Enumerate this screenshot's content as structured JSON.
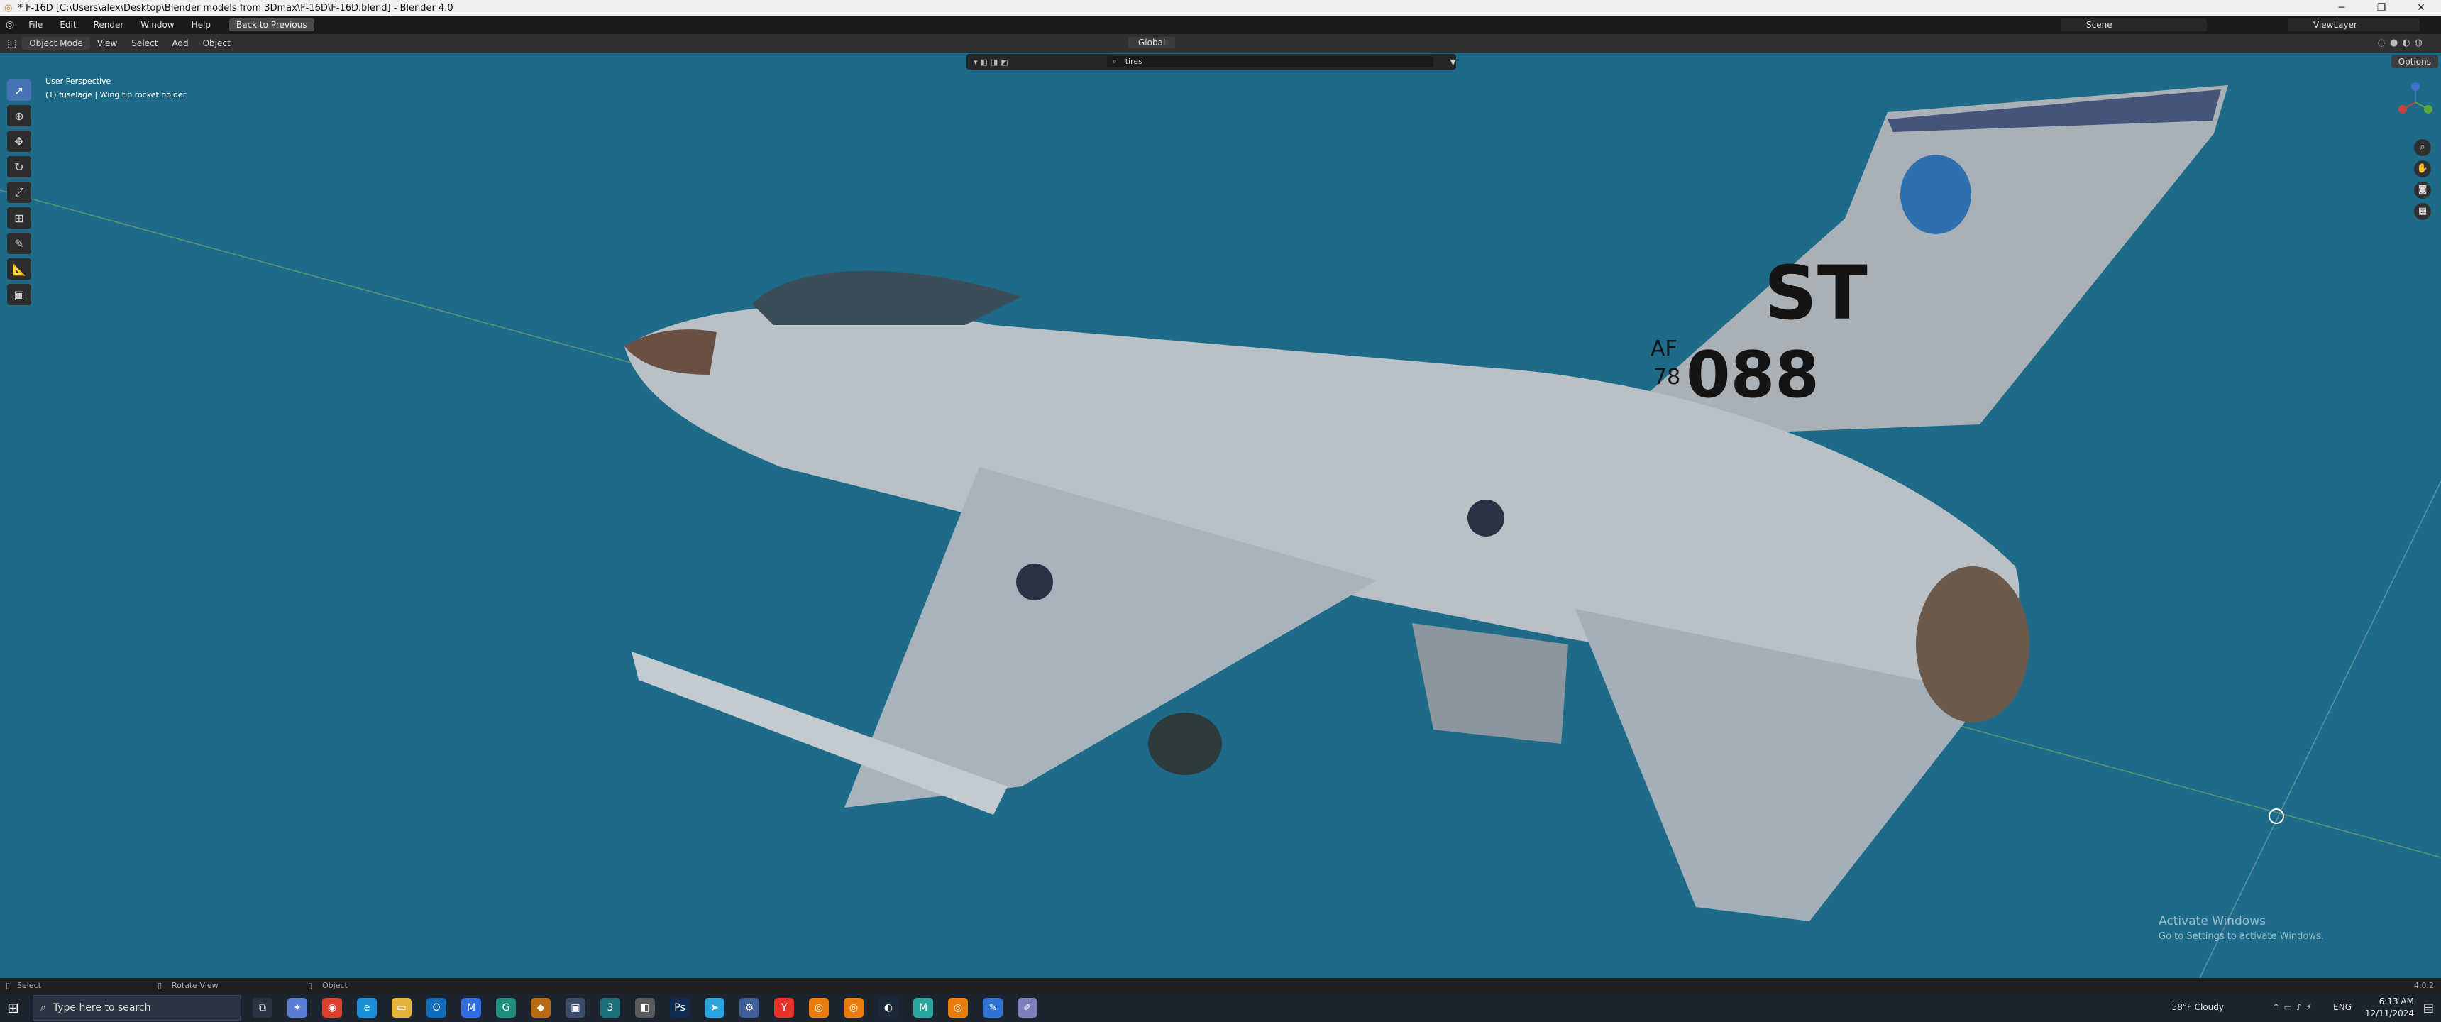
{
  "window": {
    "title": "* F-16D [C:\\Users\\alex\\Desktop\\Blender models from 3Dmax\\F-16D\\F-16D.blend] - Blender 4.0",
    "minimize": "─",
    "maximize": "❐",
    "close": "✕"
  },
  "menubar": {
    "items": [
      "File",
      "Edit",
      "Render",
      "Window",
      "Help"
    ],
    "back_button": "Back to Previous",
    "scene": "Scene",
    "view_layer": "ViewLayer"
  },
  "header": {
    "mode": "Object Mode",
    "menus": [
      "View",
      "Select",
      "Add",
      "Object"
    ],
    "orientation": "Global",
    "options": "Options"
  },
  "outliner_filter": {
    "search_value": "tires"
  },
  "viewport": {
    "perspective_label": "User Perspective",
    "selection_label": "(1) fuselage | Wing tip rocket holder"
  },
  "aircraft": {
    "tail_code": "ST",
    "af_label": "AF",
    "year": "78",
    "serial": "088"
  },
  "toolbar": {
    "tools": [
      "select-box",
      "cursor",
      "move",
      "rotate",
      "scale",
      "transform",
      "annotate",
      "measure",
      "add-cube"
    ]
  },
  "watermark": {
    "line1": "Activate Windows",
    "line2": "Go to Settings to activate Windows."
  },
  "statusbar": {
    "select": "Select",
    "rotate": "Rotate View",
    "object": "Object",
    "version": "4.0.2"
  },
  "taskbar": {
    "search_placeholder": "Type here to search",
    "weather": "58°F  Cloudy",
    "language": "ENG",
    "time": "6:13 AM",
    "date": "12/11/2024",
    "apps": [
      {
        "name": "task-view",
        "glyph": "⧉",
        "color": "#2b3441"
      },
      {
        "name": "copilot",
        "glyph": "✦",
        "color": "#5a7dd6"
      },
      {
        "name": "chrome",
        "glyph": "◉",
        "color": "#d9412e"
      },
      {
        "name": "edge",
        "glyph": "e",
        "color": "#1d8fd6"
      },
      {
        "name": "file-explorer",
        "glyph": "▭",
        "color": "#e4b43a"
      },
      {
        "name": "outlook",
        "glyph": "O",
        "color": "#0f6cbd"
      },
      {
        "name": "messenger",
        "glyph": "M",
        "color": "#2f6de1"
      },
      {
        "name": "gitkraken",
        "glyph": "G",
        "color": "#1f8f7b"
      },
      {
        "name": "app-1",
        "glyph": "◆",
        "color": "#b66a12"
      },
      {
        "name": "app-2",
        "glyph": "▣",
        "color": "#3d4c6b"
      },
      {
        "name": "3ds-max",
        "glyph": "3",
        "color": "#1d6f7a"
      },
      {
        "name": "app-3",
        "glyph": "◧",
        "color": "#5a5a5a"
      },
      {
        "name": "photoshop",
        "glyph": "Ps",
        "color": "#0f2d52"
      },
      {
        "name": "telegram",
        "glyph": "➤",
        "color": "#2aa3de"
      },
      {
        "name": "settings",
        "glyph": "⚙",
        "color": "#3f5f9a"
      },
      {
        "name": "yandex",
        "glyph": "Y",
        "color": "#e63228"
      },
      {
        "name": "blender-1",
        "glyph": "◎",
        "color": "#e87d0d"
      },
      {
        "name": "blender-2",
        "glyph": "◎",
        "color": "#e87d0d"
      },
      {
        "name": "steam",
        "glyph": "◐",
        "color": "#1b2838"
      },
      {
        "name": "maya",
        "glyph": "M",
        "color": "#2aa6a0"
      },
      {
        "name": "blender-3",
        "glyph": "◎",
        "color": "#e87d0d"
      },
      {
        "name": "sketch-app",
        "glyph": "✎",
        "color": "#2f72d1"
      },
      {
        "name": "paint-app",
        "glyph": "✐",
        "color": "#7a7fb8"
      }
    ]
  },
  "colors": {
    "viewport_bg": "#1d6b88",
    "accent": "#4772b3"
  }
}
